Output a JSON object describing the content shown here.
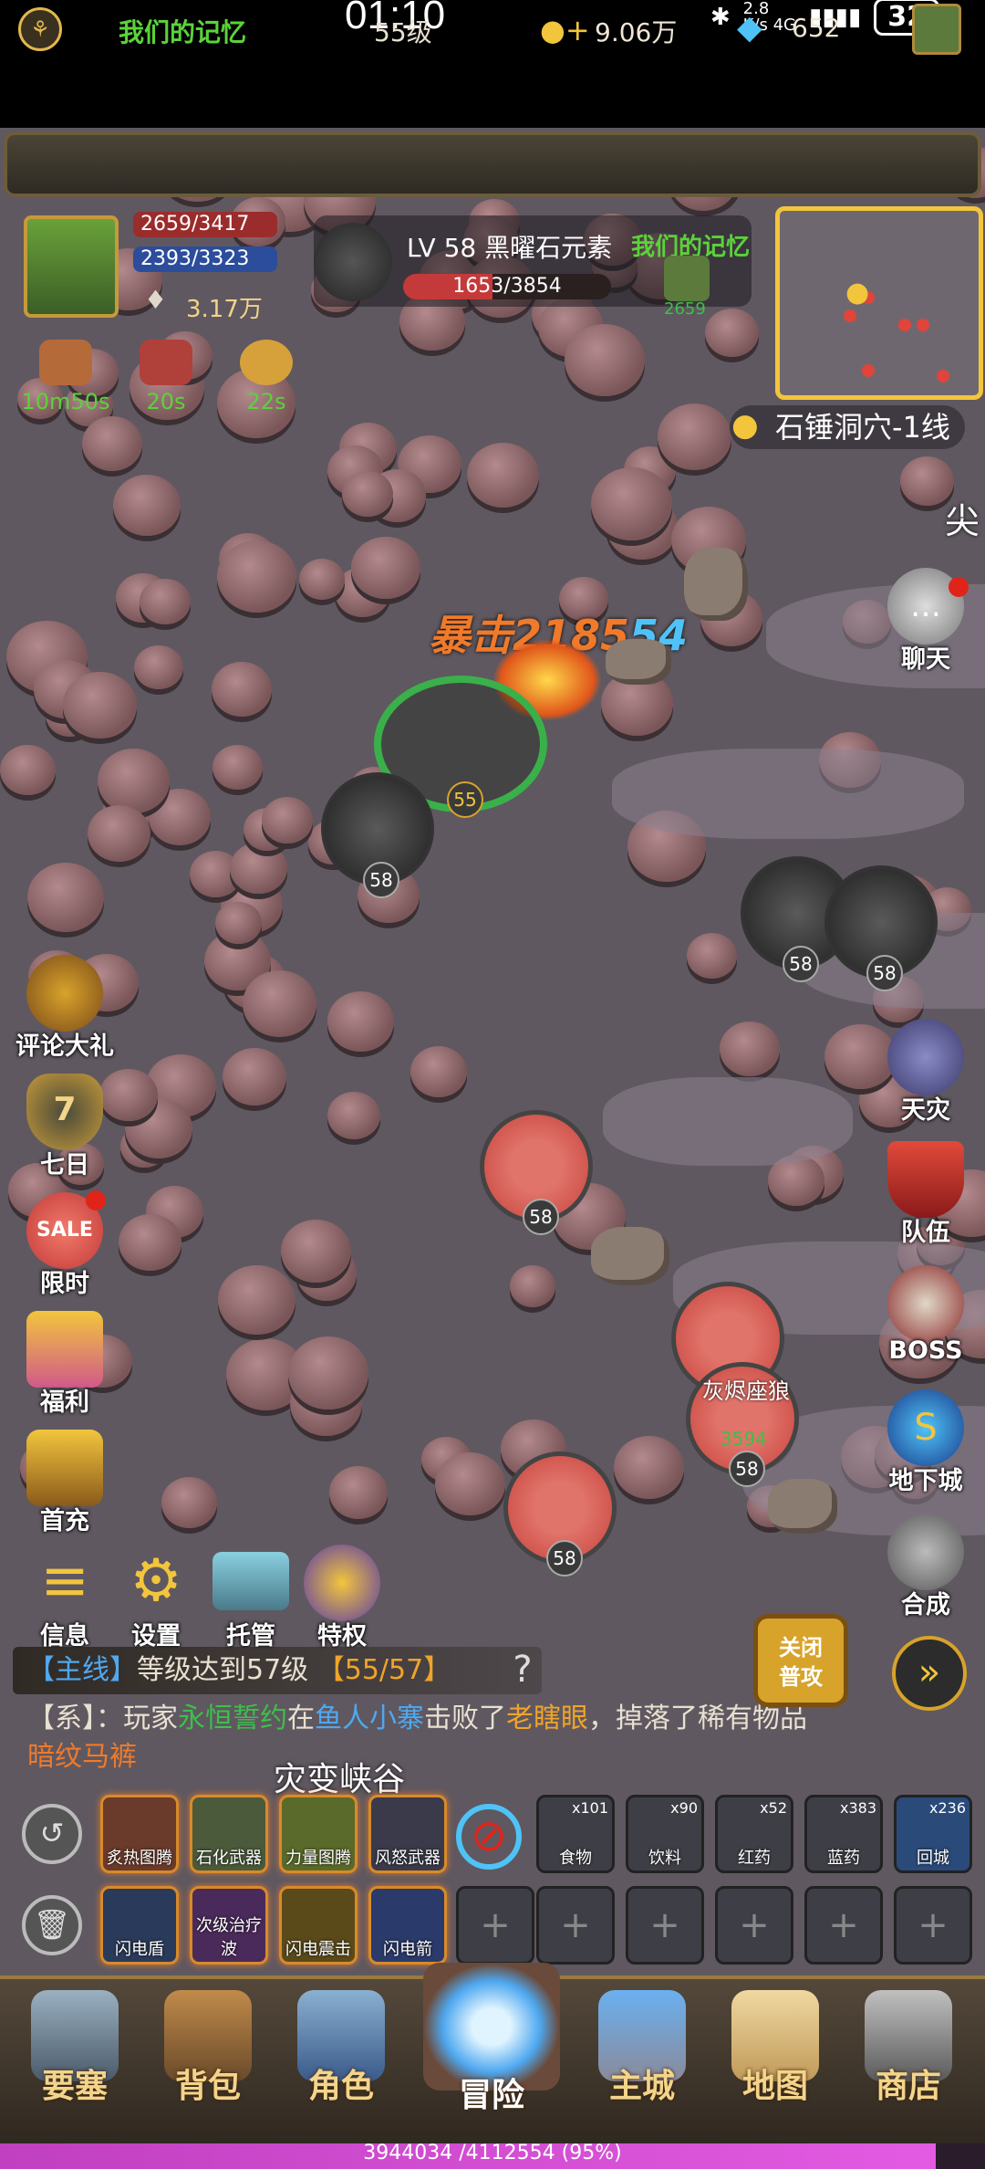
{
  "status": {
    "time": "01:10",
    "network": "2.8\nK/s 4G",
    "battery": "32"
  },
  "topbar": {
    "guild": "我们的记忆",
    "level": "55级",
    "gold": "9.06万",
    "gems": "652"
  },
  "player": {
    "hp": "2659/3417",
    "mp": "2393/3323",
    "power": "3.17万",
    "buffs": [
      {
        "icon": "meat-icon",
        "time": "10m50s"
      },
      {
        "icon": "bacon-icon",
        "time": "20s"
      },
      {
        "icon": "banana-icon",
        "time": "22s"
      }
    ]
  },
  "target": {
    "name": "LV 58 黑曜石元素",
    "hp": "1653/3854",
    "hp_fraction": 0.429,
    "guild": "我们的记忆",
    "ally_hp": "2659"
  },
  "location": "石锤洞穴-1线",
  "left_buttons": [
    {
      "name": "review-gift",
      "label": "评论大礼"
    },
    {
      "name": "seven-days",
      "label": "七日"
    },
    {
      "name": "limited",
      "label": "限时"
    },
    {
      "name": "welfare",
      "label": "福利"
    },
    {
      "name": "first-charge",
      "label": "首充"
    }
  ],
  "right_buttons": [
    {
      "name": "chat",
      "label": "聊天"
    },
    {
      "name": "disaster",
      "label": "天灾"
    },
    {
      "name": "team",
      "label": "队伍"
    },
    {
      "name": "boss",
      "label": "BOSS"
    },
    {
      "name": "dungeon",
      "label": "地下城"
    },
    {
      "name": "craft",
      "label": "合成"
    }
  ],
  "right_edge_text": "尖",
  "menu_buttons": [
    {
      "name": "info",
      "label": "信息"
    },
    {
      "name": "settings",
      "label": "设置"
    },
    {
      "name": "auto",
      "label": "托管"
    },
    {
      "name": "privilege",
      "label": "特权"
    }
  ],
  "battle": {
    "crit_text": "暴击",
    "crit_value": "2185",
    "crit_suffix": "54",
    "player_level": "55",
    "mob_level": "58",
    "wolf_name": "灰烬座狼",
    "wolf_hp": "3594"
  },
  "quest": {
    "tag": "【主线】",
    "text": "等级达到57级",
    "progress": "【55/57】"
  },
  "system_msg": {
    "prefix": "【系】：",
    "part1": "玩家",
    "player": "永恒誓约",
    "part2": "在",
    "place": "鱼人小寨",
    "part3": "击败了",
    "boss": "老瞎眼",
    "part4": "，掉落了稀有物品",
    "item": "暗纹马裤"
  },
  "zone_name": "灾变峡谷",
  "attack_toggle": {
    "line1": "关闭",
    "line2": "普攻"
  },
  "skills_row1": [
    {
      "label": "炙热图腾"
    },
    {
      "label": "石化武器"
    },
    {
      "label": "力量图腾"
    },
    {
      "label": "风怒武器"
    }
  ],
  "items": [
    {
      "label": "食物",
      "count": "x101"
    },
    {
      "label": "饮料",
      "count": "x90"
    },
    {
      "label": "红药",
      "count": "x52"
    },
    {
      "label": "蓝药",
      "count": "x383"
    },
    {
      "label": "回城",
      "count": "x236"
    }
  ],
  "skills_row2": [
    {
      "label": "闪电盾"
    },
    {
      "label": "次级治疗波"
    },
    {
      "label": "闪电震击"
    },
    {
      "label": "闪电箭"
    }
  ],
  "nav": [
    {
      "name": "fortress",
      "label": "要塞"
    },
    {
      "name": "bag",
      "label": "背包"
    },
    {
      "name": "character",
      "label": "角色"
    },
    {
      "name": "adventure",
      "label": "冒险"
    },
    {
      "name": "main-city",
      "label": "主城"
    },
    {
      "name": "map",
      "label": "地图"
    },
    {
      "name": "shop",
      "label": "商店"
    }
  ],
  "exp": {
    "text": "3944034 /4112554 (95%)",
    "fraction": 0.95
  }
}
